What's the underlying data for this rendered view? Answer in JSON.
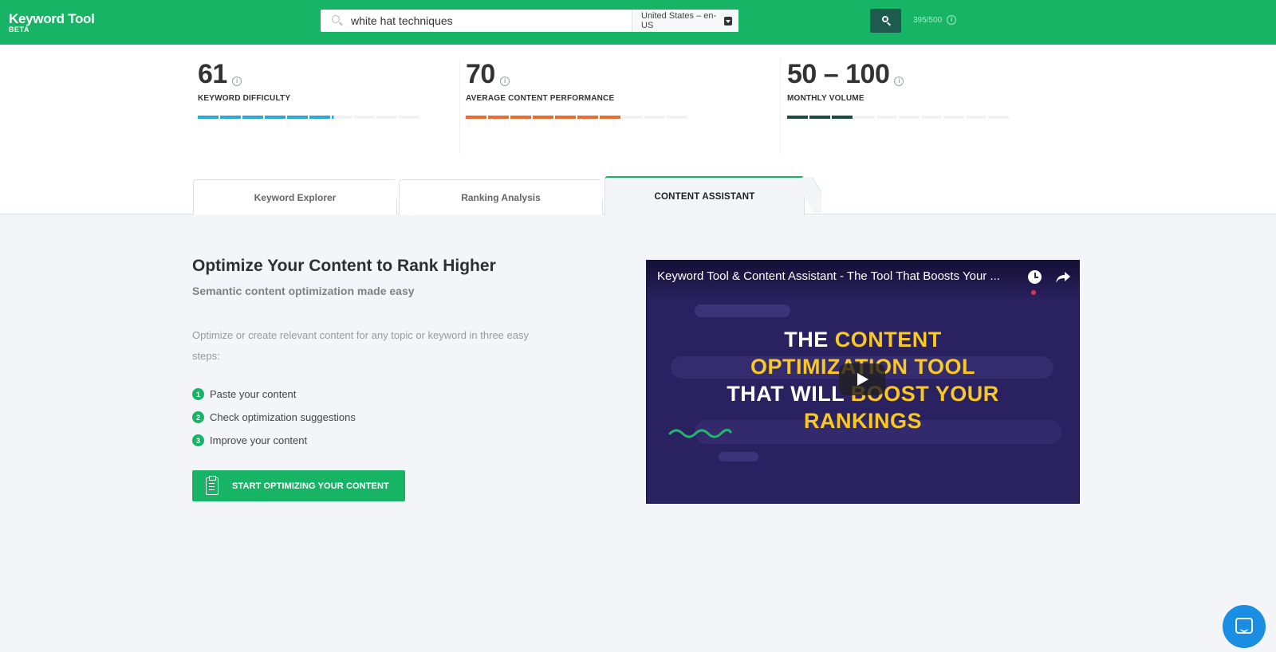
{
  "app": {
    "logo_title": "Keyword Tool",
    "logo_badge": "BETA",
    "brand_color": "#18b466"
  },
  "search": {
    "query": "white hat techniques",
    "locale": "United States – en-US",
    "credits": "395/500"
  },
  "metrics": [
    {
      "value": "61",
      "label": "KEYWORD DIFFICULTY",
      "color": "#29a7df",
      "fill_fraction": 0.61
    },
    {
      "value": "70",
      "label": "AVERAGE CONTENT PERFORMANCE",
      "color": "#ee6a2f",
      "fill_fraction": 0.7
    },
    {
      "value": "50 – 100",
      "label": "MONTHLY VOLUME",
      "color": "#1d4a42",
      "fill_fraction": 0.3
    }
  ],
  "tabs": [
    {
      "label": "Keyword Explorer",
      "active": false
    },
    {
      "label": "Ranking Analysis",
      "active": false
    },
    {
      "label": "CONTENT ASSISTANT",
      "active": true
    }
  ],
  "content": {
    "title": "Optimize Your Content to Rank Higher",
    "subtitle": "Semantic content optimization made easy",
    "description": "Optimize or create relevant content for any topic or keyword in three easy steps:",
    "steps": [
      {
        "num": "1",
        "text": "Paste your content"
      },
      {
        "num": "2",
        "text": "Check optimization suggestions"
      },
      {
        "num": "3",
        "text": "Improve your content"
      }
    ],
    "cta_label": "START OPTIMIZING YOUR CONTENT"
  },
  "video": {
    "title": "Keyword Tool & Content Assistant - The Tool That Boosts Your ...",
    "headline_line1_white": "THE ",
    "headline_line1_yellow": "CONTENT",
    "headline_line2_yellow": "OPTIMIZATION TOOL",
    "headline_line3_white": "THAT WILL ",
    "headline_line3_yellow": "BOOST YOUR",
    "headline_line4_yellow": "RANKINGS"
  },
  "icons": [
    "search-icon",
    "dropdown-arrow-icon",
    "info-icon",
    "clipboard-icon",
    "clock-icon",
    "share-icon",
    "play-icon",
    "chat-icon"
  ]
}
